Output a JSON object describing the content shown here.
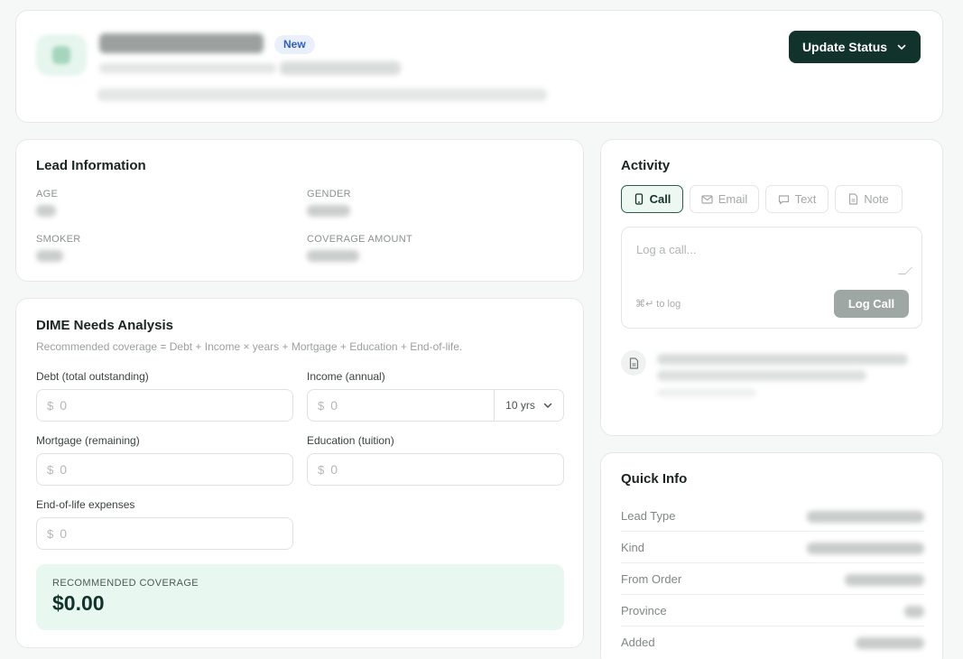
{
  "header": {
    "badge": "New",
    "update_status_label": "Update Status"
  },
  "lead_info": {
    "title": "Lead Information",
    "fields": [
      {
        "label": "AGE"
      },
      {
        "label": "GENDER"
      },
      {
        "label": "SMOKER"
      },
      {
        "label": "COVERAGE AMOUNT"
      }
    ]
  },
  "dime": {
    "title": "DIME Needs Analysis",
    "subtitle": "Recommended coverage = Debt + Income × years + Mortgage + Education + End-of-life.",
    "currency_symbol": "$",
    "debt": {
      "label": "Debt (total outstanding)",
      "placeholder": "0"
    },
    "income": {
      "label": "Income (annual)",
      "placeholder": "0",
      "years": "10 yrs"
    },
    "mortgage": {
      "label": "Mortgage (remaining)",
      "placeholder": "0"
    },
    "education": {
      "label": "Education (tuition)",
      "placeholder": "0"
    },
    "end_of_life": {
      "label": "End-of-life expenses",
      "placeholder": "0"
    },
    "recommended_label": "RECOMMENDED COVERAGE",
    "recommended_value": "$0.00",
    "accent_color": "#e8f8f1"
  },
  "activity": {
    "title": "Activity",
    "tabs": [
      {
        "label": "Call",
        "icon": "phone-icon",
        "active": true
      },
      {
        "label": "Email",
        "icon": "mail-icon",
        "active": false
      },
      {
        "label": "Text",
        "icon": "message-icon",
        "active": false
      },
      {
        "label": "Note",
        "icon": "note-icon",
        "active": false
      }
    ],
    "composer_placeholder": "Log a call...",
    "composer_hint": "⌘↵ to log",
    "log_button": "Log Call"
  },
  "quick_info": {
    "title": "Quick Info",
    "rows": [
      {
        "label": "Lead Type"
      },
      {
        "label": "Kind"
      },
      {
        "label": "From Order"
      },
      {
        "label": "Province"
      },
      {
        "label": "Added"
      }
    ]
  },
  "colors": {
    "brand_dark": "#12322c",
    "badge_blue": "#2f5fc6",
    "disabled_button": "#9fa7a4"
  }
}
